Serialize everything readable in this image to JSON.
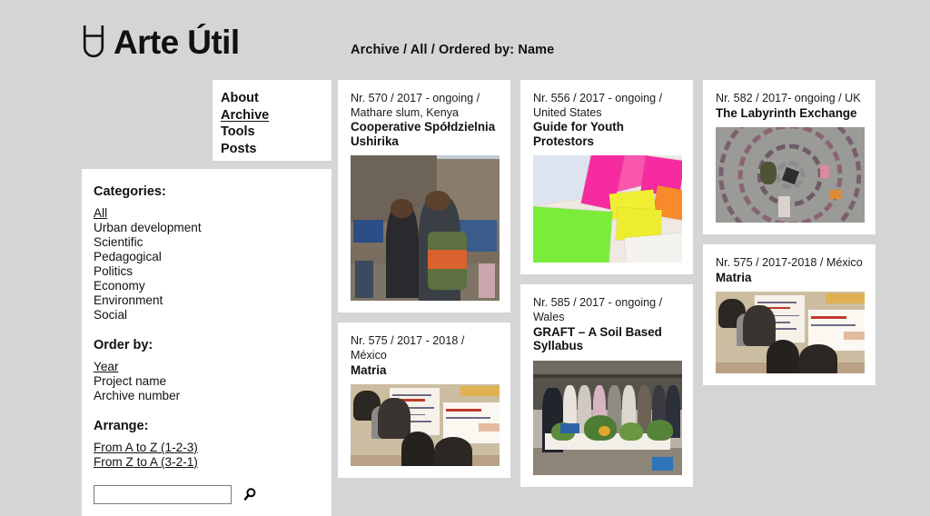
{
  "site": {
    "logo_text": "Arte Útil",
    "logo_icon": "magnet-u-icon"
  },
  "breadcrumb": "Archive / All / Ordered by: Name",
  "nav": {
    "items": [
      {
        "label": "About",
        "active": false
      },
      {
        "label": "Archive",
        "active": true
      },
      {
        "label": "Tools",
        "active": false
      },
      {
        "label": "Posts",
        "active": false
      }
    ]
  },
  "sidebar": {
    "categories": {
      "heading": "Categories:",
      "items": [
        {
          "label": "All",
          "active": true
        },
        {
          "label": "Urban development",
          "active": false
        },
        {
          "label": "Scientific",
          "active": false
        },
        {
          "label": "Pedagogical",
          "active": false
        },
        {
          "label": "Politics",
          "active": false
        },
        {
          "label": "Economy",
          "active": false
        },
        {
          "label": "Environment",
          "active": false
        },
        {
          "label": "Social",
          "active": false
        }
      ]
    },
    "order_by": {
      "heading": "Order by:",
      "items": [
        {
          "label": "Year",
          "active": true
        },
        {
          "label": "Project name",
          "active": false
        },
        {
          "label": "Archive number",
          "active": false
        }
      ]
    },
    "arrange": {
      "heading": "Arrange:",
      "items": [
        {
          "label": "From A to Z (1-2-3)",
          "active": true
        },
        {
          "label": "From Z to A (3-2-1)",
          "active": true
        }
      ]
    },
    "search": {
      "value": "",
      "placeholder": "",
      "icon": "search-icon"
    }
  },
  "archive": {
    "columns": [
      {
        "cards": [
          {
            "meta": "Nr. 570 / 2017 - ongoing / Mathare slum, Kenya",
            "title": "Cooperative Spółdzielnia Ushirika",
            "thumb": "kenya",
            "thumb_height": 160
          },
          {
            "meta": "Nr. 575 / 2017 - 2018 / México",
            "title": "Matria",
            "thumb": "work",
            "thumb_height": 90
          }
        ]
      },
      {
        "cards": [
          {
            "meta": "Nr. 556 / 2017 - ongoing / United States",
            "title": "Guide for Youth Protestors",
            "thumb": "tickets",
            "thumb_height": 118
          },
          {
            "meta": "Nr. 585 / 2017 - ongoing / Wales",
            "title": "GRAFT – A Soil Based Syllabus",
            "thumb": "graft",
            "thumb_height": 126
          }
        ]
      },
      {
        "cards": [
          {
            "meta": "Nr. 582 / 2017- ongoing / UK",
            "title": "The Labyrinth Exchange",
            "thumb": "laby",
            "thumb_height": 105
          },
          {
            "meta": "Nr. 575 / 2017-2018 / México",
            "title": "Matria",
            "thumb": "work",
            "thumb_height": 90
          }
        ]
      }
    ]
  },
  "colors": {
    "page_background": "#d5d5d5",
    "panel": "#ffffff",
    "text": "#111111",
    "input_border": "#7b7b7b"
  }
}
